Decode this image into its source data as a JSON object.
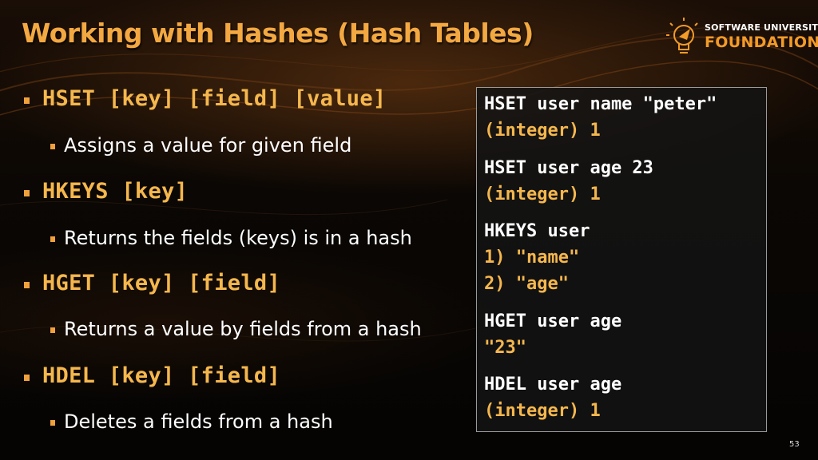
{
  "slide": {
    "title": "Working with Hashes (Hash Tables)",
    "page_number": "53"
  },
  "logo": {
    "line1": "SOFTWARE UNIVERSITY",
    "line2": "FOUNDATION",
    "icon": "lightbulb-icon"
  },
  "bullets": [
    {
      "level": 1,
      "text": "HSET [key] [field] [value]"
    },
    {
      "level": 2,
      "text": "Assigns a value for given field"
    },
    {
      "level": 1,
      "text": "HKEYS [key]"
    },
    {
      "level": 2,
      "text": "Returns the fields (keys) is in a hash"
    },
    {
      "level": 1,
      "text": "HGET [key] [field]"
    },
    {
      "level": 2,
      "text": "Returns a value by fields from a hash"
    },
    {
      "level": 1,
      "text": "HDEL [key] [field]"
    },
    {
      "level": 2,
      "text": "Deletes a fields from a hash"
    }
  ],
  "code_box": {
    "lines": [
      {
        "kind": "cmd",
        "text": "HSET user name \"peter\""
      },
      {
        "kind": "res",
        "text": "(integer) 1"
      },
      {
        "kind": "cmd",
        "text": "HSET user age 23"
      },
      {
        "kind": "res",
        "text": "(integer) 1"
      },
      {
        "kind": "cmd",
        "text": "HKEYS user"
      },
      {
        "kind": "res",
        "text": "1) \"name\""
      },
      {
        "kind": "res",
        "text": "2) \"age\""
      },
      {
        "kind": "cmd",
        "text": "HGET user age"
      },
      {
        "kind": "res",
        "text": "\"23\""
      },
      {
        "kind": "cmd",
        "text": "HDEL user age"
      },
      {
        "kind": "res",
        "text": "(integer) 1"
      }
    ]
  },
  "colors": {
    "title": "#f3a841",
    "bullet_mono": "#f5b74d",
    "bullet_square": "#f0a13c",
    "body_text": "#ffffff",
    "code_result": "#f5b74d",
    "logo_accent": "#f39a28"
  }
}
